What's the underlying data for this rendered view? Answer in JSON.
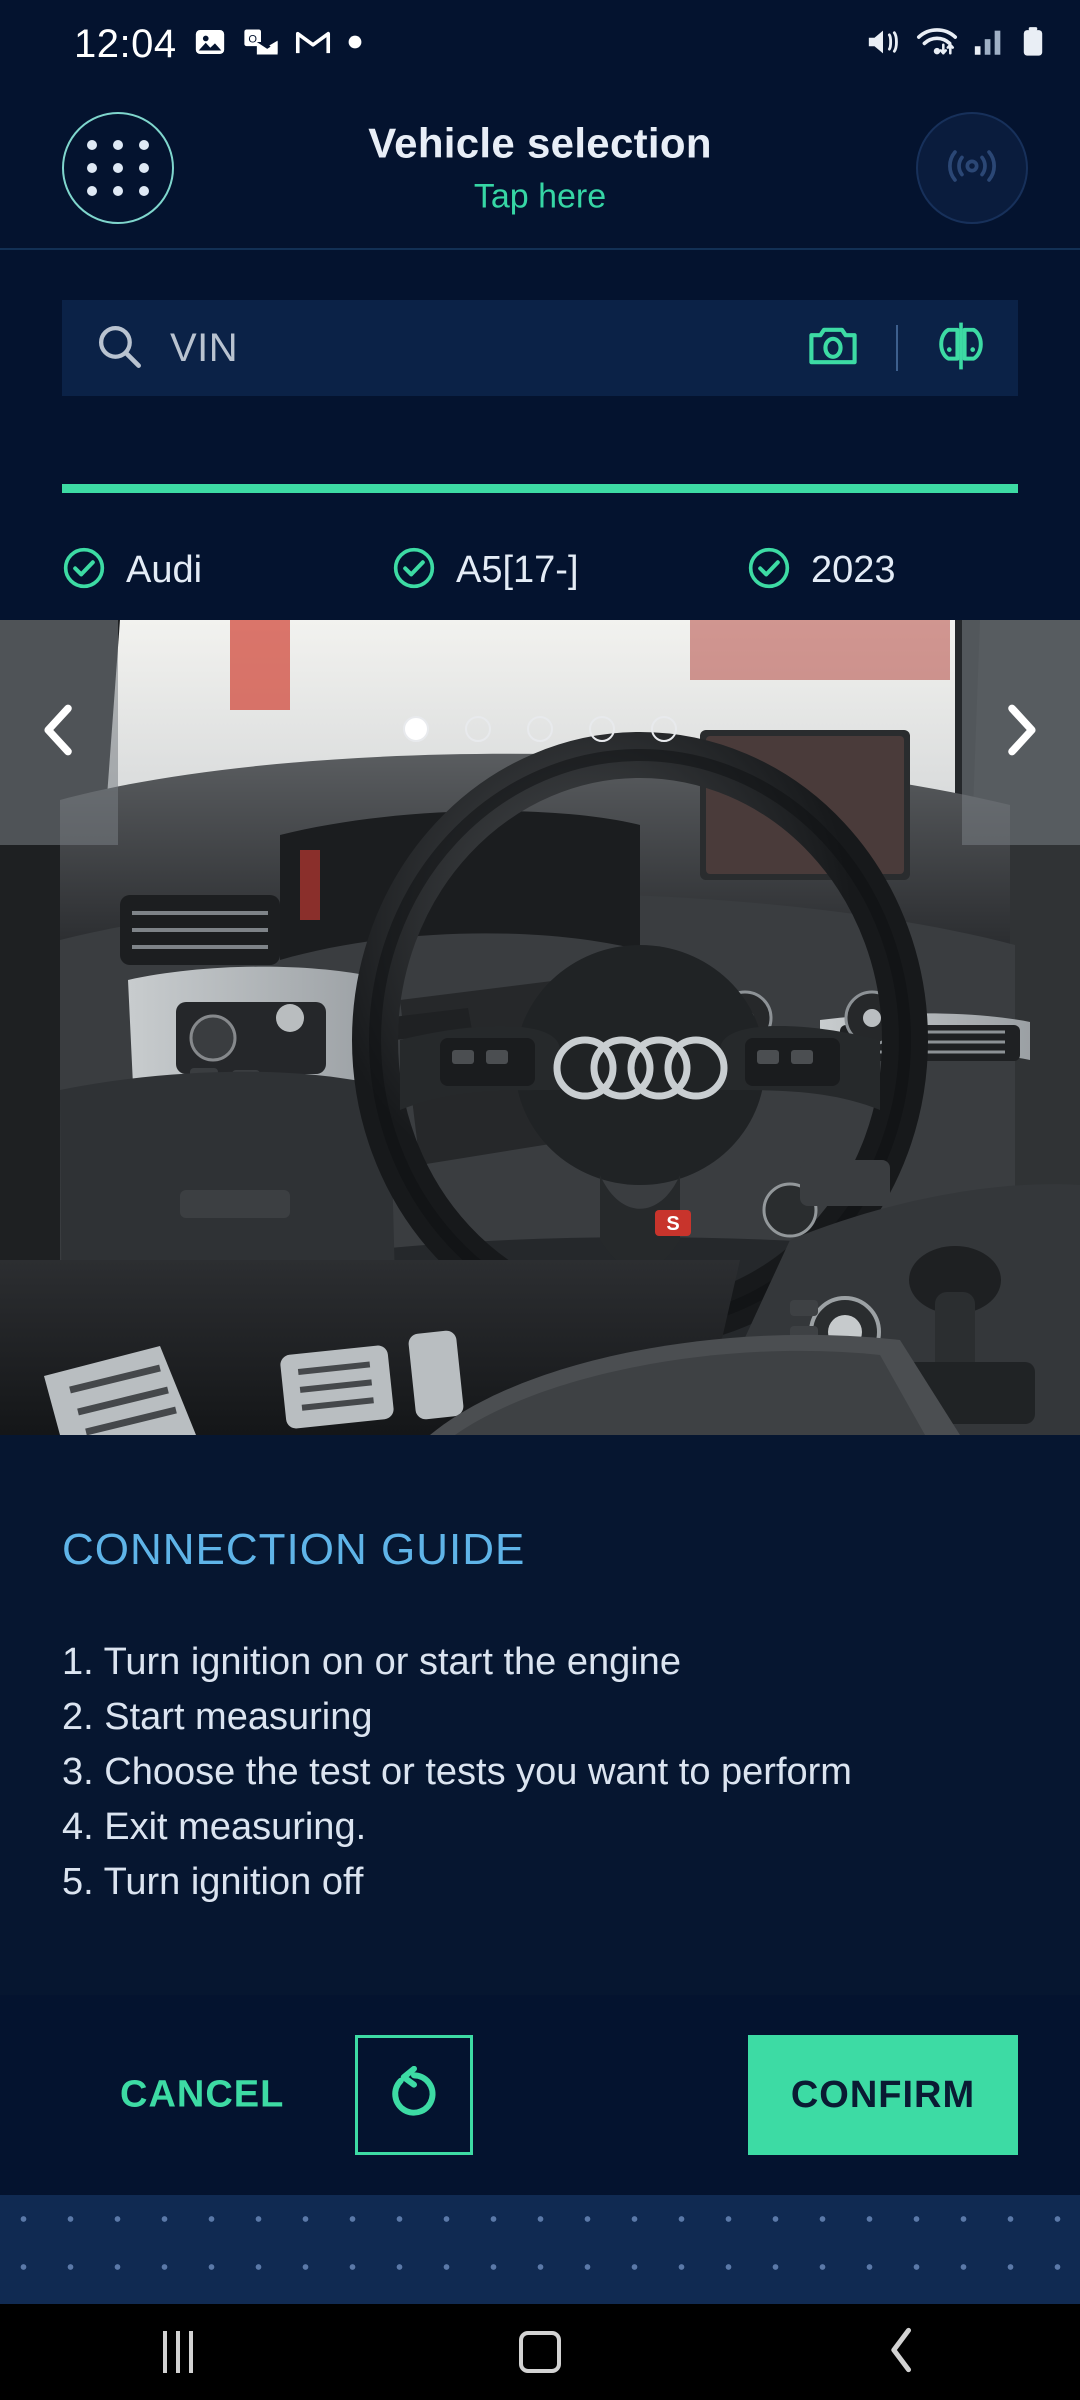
{
  "statusbar": {
    "clock": "12:04",
    "left_icons": [
      "photos-icon",
      "outlook-icon",
      "gmail-icon",
      "notification-dot-icon"
    ],
    "right_icons": [
      "mute-vibrate-icon",
      "wifi-icon",
      "cellular-signal-icon",
      "battery-icon"
    ]
  },
  "header": {
    "menu_icon": "apps-grid-icon",
    "title": "Vehicle selection",
    "subtitle": "Tap here",
    "connection_icon": "wireless-connection-icon"
  },
  "search": {
    "icon": "search-icon",
    "placeholder": "VIN",
    "value": "",
    "camera_icon": "camera-icon",
    "vehicle_icon": "vehicle-compare-icon"
  },
  "selection": {
    "progress_percent": 100,
    "chips": [
      {
        "label": "Audi",
        "icon": "check-circle-icon",
        "checked": true
      },
      {
        "label": "A5[17-]",
        "icon": "check-circle-icon",
        "checked": true
      },
      {
        "label": "2023",
        "icon": "check-circle-icon",
        "checked": true
      }
    ]
  },
  "carousel": {
    "prev_icon": "chevron-left-icon",
    "next_icon": "chevron-right-icon",
    "total_slides": 5,
    "active_slide": 1,
    "image_alt": "Audi A5 interior dashboard with steering wheel"
  },
  "guide": {
    "title": "CONNECTION GUIDE",
    "steps": [
      "1. Turn ignition on or start the engine",
      "2. Start measuring",
      "3. Choose the test or tests you want to perform",
      "4. Exit measuring.",
      "5. Turn ignition off"
    ]
  },
  "actions": {
    "cancel_label": "CANCEL",
    "refresh_icon": "refresh-icon",
    "confirm_label": "CONFIRM"
  },
  "navbar": {
    "recents_icon": "recents-icon",
    "home_icon": "home-icon",
    "back_icon": "back-icon"
  },
  "colors": {
    "background": "#04132f",
    "panel": "#061630",
    "accent_teal": "#3ddba4",
    "accent_blue": "#5fb4e8",
    "search_field": "#0b2247",
    "band": "#102a52"
  }
}
